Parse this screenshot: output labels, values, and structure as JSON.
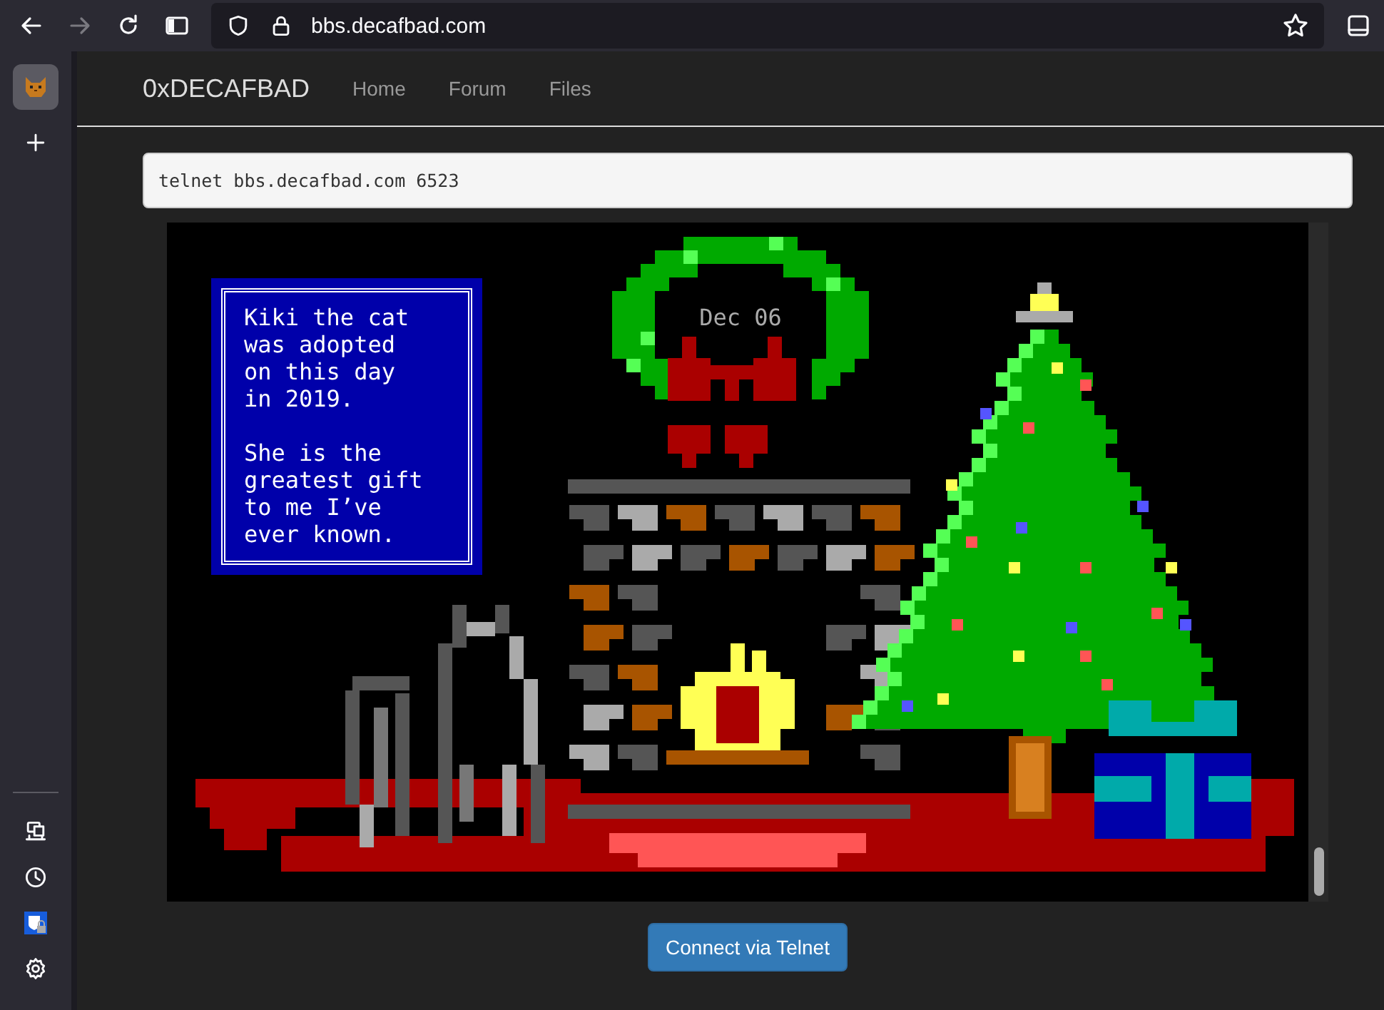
{
  "browser": {
    "url": "bbs.decafbad.com",
    "forward_disabled": true
  },
  "navbar": {
    "brand": "0xDECAFBAD",
    "links": [
      {
        "label": "Home"
      },
      {
        "label": "Forum"
      },
      {
        "label": "Files"
      }
    ]
  },
  "command": {
    "value": "telnet bbs.decafbad.com 6523"
  },
  "terminal": {
    "date": "Dec 06",
    "message": [
      "Kiki the cat was adopted on this day in 2019.",
      "She is the greatest gift to me I’ve ever known."
    ]
  },
  "connect_button": "Connect via Telnet"
}
